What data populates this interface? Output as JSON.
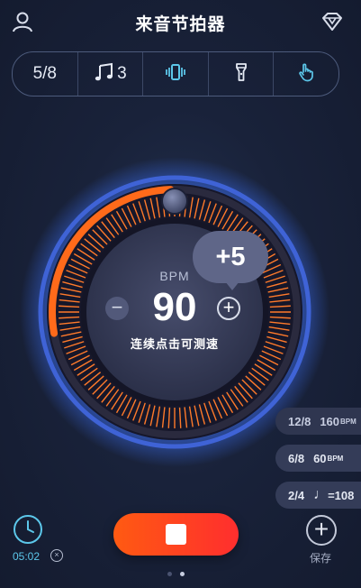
{
  "header": {
    "title": "来音节拍器",
    "left_icon": "user-icon",
    "right_icon": "diamond-icon"
  },
  "toolbar": {
    "time_signature": "5/8",
    "subdivision_count": "3",
    "subdivision_icon": "music-note-icon",
    "vibrate_icon": "vibrate-icon",
    "flashlight_icon": "flashlight-icon",
    "tap_icon": "hand-tap-icon"
  },
  "tempo": {
    "bpm_label": "BPM",
    "bpm_value": "90",
    "hint": "连续点击可测速",
    "increment_bubble": "+5",
    "minus_label": "−",
    "plus_label": "+"
  },
  "presets": [
    {
      "meter": "12/8",
      "tempo": "160",
      "unit": "BPM"
    },
    {
      "meter": "6/8",
      "tempo": "60",
      "unit": "BPM"
    },
    {
      "meter": "2/4",
      "note": "♩",
      "tempo": "=108"
    }
  ],
  "timer": {
    "value": "05:02",
    "close_label": "×"
  },
  "save": {
    "label": "保存",
    "icon_label": "+"
  },
  "pager": {
    "count": 2,
    "active": 1
  },
  "colors": {
    "accent_orange": "#ff6a1a",
    "accent_blue": "#5cc7ea",
    "stop_red": "#ff2e2e",
    "ring_blue": "#3f7cff"
  }
}
